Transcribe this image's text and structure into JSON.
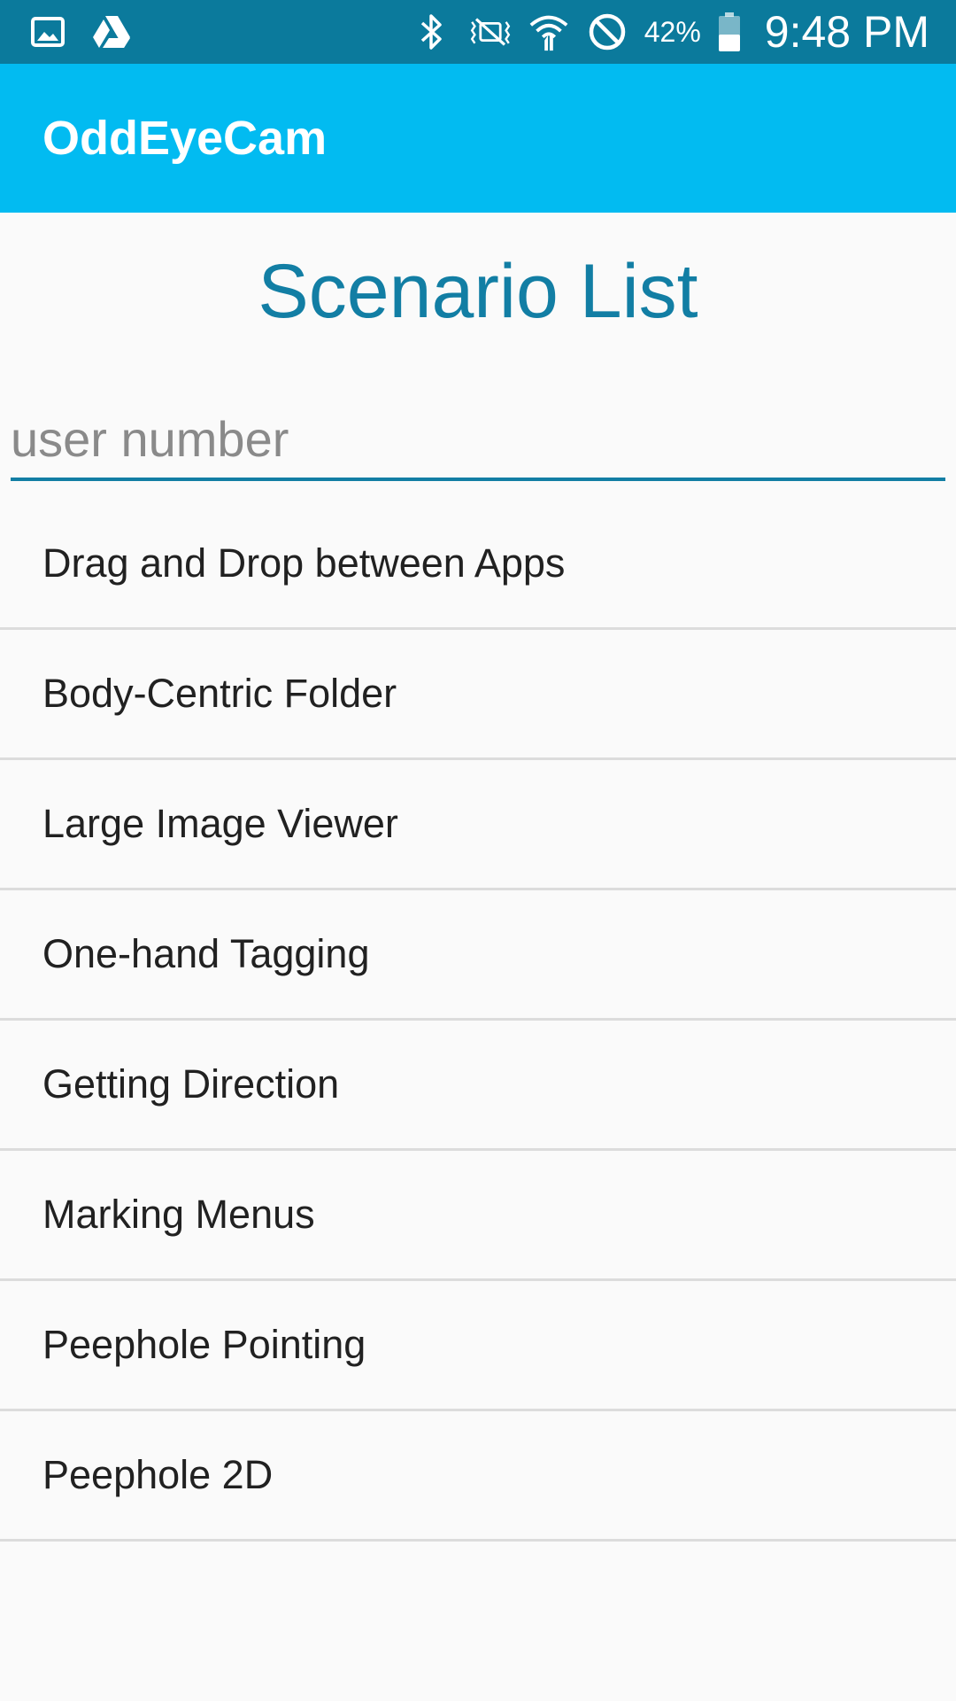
{
  "status_bar": {
    "battery": "42%",
    "time": "9:48 PM",
    "left_icons": [
      "gallery-icon",
      "drive-icon"
    ],
    "right_icons": [
      "bluetooth-icon",
      "vibrate-icon",
      "wifi-icon",
      "blocked-icon",
      "battery-icon"
    ]
  },
  "app_bar": {
    "title": "OddEyeCam"
  },
  "main": {
    "heading": "Scenario List",
    "user_input": {
      "placeholder": "user number",
      "value": ""
    },
    "scenarios": [
      {
        "label": "Drag and Drop between Apps"
      },
      {
        "label": "Body-Centric Folder"
      },
      {
        "label": "Large Image Viewer"
      },
      {
        "label": "One-hand Tagging"
      },
      {
        "label": "Getting Direction"
      },
      {
        "label": "Marking Menus"
      },
      {
        "label": "Peephole Pointing"
      },
      {
        "label": "Peephole 2D"
      }
    ]
  },
  "colors": {
    "status_bar": "#0b7a9c",
    "app_bar": "#02bbf1",
    "accent": "#127ea4",
    "background": "#fafafa",
    "divider": "#dcdcdc"
  }
}
